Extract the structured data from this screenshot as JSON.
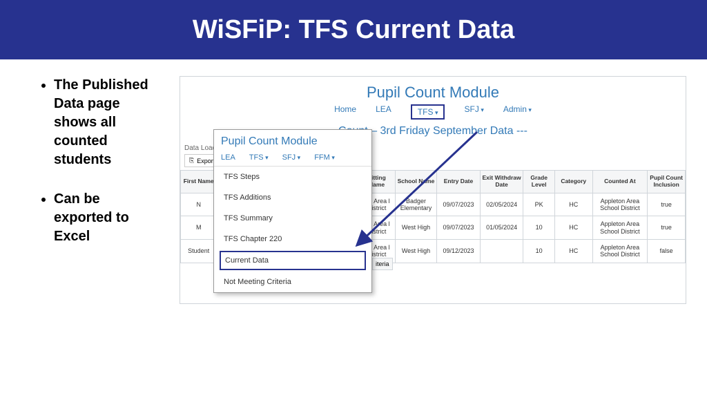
{
  "banner": {
    "title": "WiSFiP: TFS Current Data"
  },
  "bullets": [
    "The Published Data page shows all counted students",
    "Can be exported to Excel"
  ],
  "shot": {
    "module_title": "Pupil Count Module",
    "nav": {
      "home": "Home",
      "lea": "LEA",
      "tfs": "TFS",
      "sfj": "SFJ",
      "admin": "Admin"
    },
    "subhead": "Count – 3rd Friday September Data ---",
    "data_load": "Data Load",
    "export": "Export",
    "columns": {
      "first_name": "First Name",
      "sitting_name": "Sitting Name",
      "school_name": "School Name",
      "entry_date": "Entry Date",
      "exit_withdraw_date": "Exit Withdraw Date",
      "grade_level": "Grade Level",
      "category": "Category",
      "counted_at": "Counted At",
      "pupil_count_inclusion": "Pupil Count Inclusion"
    },
    "rows": [
      {
        "first_name": "N",
        "sitting": "ton Area l District",
        "school": "Badger Elementary",
        "entry": "09/07/2023",
        "withdraw": "02/05/2024",
        "grade": "PK",
        "category": "HC",
        "counted": "Appleton Area School District",
        "inclusion": "true"
      },
      {
        "first_name": "M",
        "sitting": "ton Area l District",
        "school": "West High",
        "entry": "09/07/2023",
        "withdraw": "01/05/2024",
        "grade": "10",
        "category": "HC",
        "counted": "Appleton Area School District",
        "inclusion": "true"
      },
      {
        "first_name": "Student",
        "sitting": "ton Area l District",
        "school": "West High",
        "entry": "09/12/2023",
        "withdraw": "",
        "grade": "10",
        "category": "HC",
        "counted": "Appleton Area School District",
        "inclusion": "false"
      }
    ],
    "overlay": {
      "title": "Pupil Count Module",
      "nav": {
        "lea": "LEA",
        "tfs": "TFS",
        "sfj": "SFJ",
        "ffm": "FFM"
      },
      "menu": [
        "TFS Steps",
        "TFS Additions",
        "TFS Summary",
        "TFS Chapter 220",
        "Current Data",
        "Not Meeting Criteria"
      ],
      "criteria_label": "iteria"
    }
  }
}
